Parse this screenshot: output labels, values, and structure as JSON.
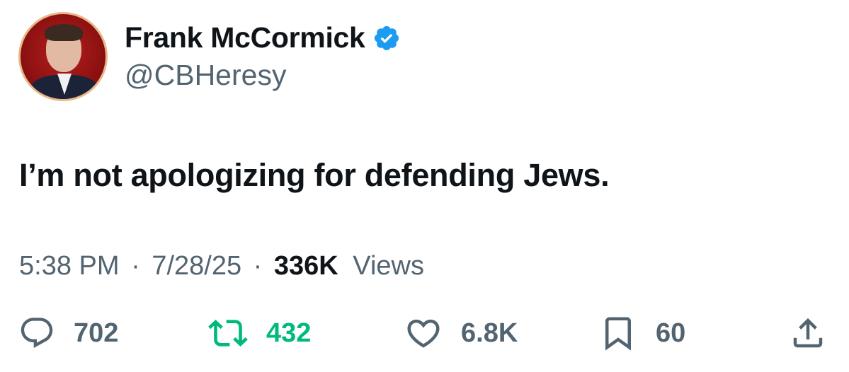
{
  "author": {
    "display_name": "Frank McCormick",
    "handle": "@CBHeresy",
    "verified": true,
    "verified_color": "#1d9bf0"
  },
  "tweet": {
    "text": "I’m not apologizing for defending Jews."
  },
  "meta": {
    "time": "5:38 PM",
    "separator": "·",
    "date": "7/28/25",
    "views_count": "336K",
    "views_label": "Views"
  },
  "actions": {
    "replies": "702",
    "retweets": "432",
    "likes": "6.8K",
    "bookmarks": "60"
  },
  "colors": {
    "text_primary": "#0f1419",
    "text_secondary": "#536471",
    "retweet_green": "#00ba7c"
  }
}
